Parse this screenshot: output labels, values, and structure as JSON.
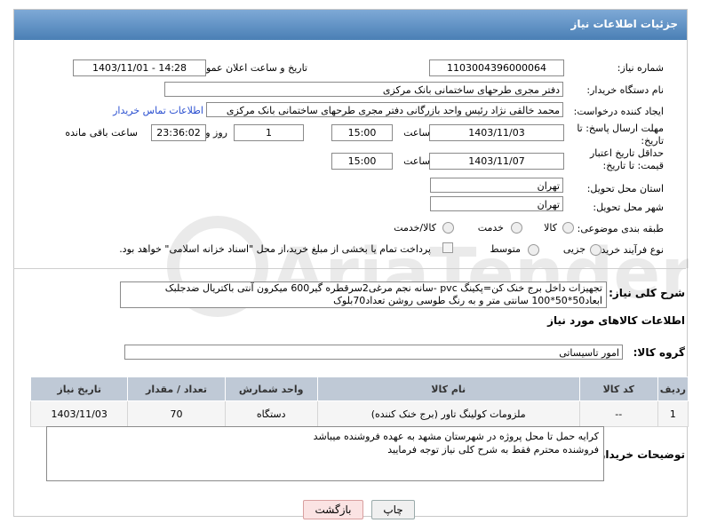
{
  "header": {
    "title": "جزئیات اطلاعات نیاز"
  },
  "fields": {
    "need_number_label": "شماره نیاز:",
    "need_number": "1103004396000064",
    "announce_label": "تاریخ و ساعت اعلان عمومی:",
    "announce_value": "1403/11/01 - 14:28",
    "buyer_org_label": "نام دستگاه خریدار:",
    "buyer_org": "دفتر مجری طرحهای ساختمانی بانک مرکزی",
    "creator_label": "ایجاد کننده درخواست:",
    "creator": "محمد خالقی نژاد رئیس واحد بازرگانی دفتر مجری طرحهای ساختمانی بانک مرکزی",
    "contact_link": "اطلاعات تماس خریدار",
    "deadline_label": "مهلت ارسال پاسخ: تا تاریخ:",
    "deadline_date": "1403/11/03",
    "time_label": "ساعت",
    "deadline_time": "15:00",
    "day_value": "1",
    "day_label": "روز و",
    "remaining_time": "23:36:02",
    "remaining_label": "ساعت باقی مانده",
    "price_valid_label": "حداقل تاریخ اعتبار قیمت: تا تاریخ:",
    "price_valid_date": "1403/11/07",
    "price_valid_time": "15:00",
    "province_label": "استان محل تحویل:",
    "province": "تهران",
    "city_label": "شهر محل تحویل:",
    "city": "تهران",
    "category_label": "طبقه بندی موضوعی:",
    "category_options": [
      "کالا",
      "خدمت",
      "کالا/خدمت"
    ],
    "process_label": "نوع فرآیند خرید :",
    "process_options": [
      "جزیی",
      "متوسط"
    ],
    "process_note": "پرداخت تمام یا بخشی از مبلغ خرید،از محل \"اسناد خزانه اسلامی\" خواهد بود.",
    "description_label": "شرح کلی نیاز:",
    "description_line1": "تجهیزات داخل برج خنک کن=پکینگ pvc -سانه نجم مرغی2سرقطره گیر600 میکرون آنتی باکتریال ضدجلبک",
    "description_line2": "ابعاد50*50*100 سانتی متر و به رنگ طوسی روشن تعداد70بلوک",
    "goods_info_title": "اطلاعات کالاهای مورد نیاز",
    "goods_group_label": "گروه کالا:",
    "goods_group": "امور تاسیساتی",
    "notes_label": "توضیحات خریدار:",
    "notes_line1": "کرایه حمل تا محل پروژه در شهرستان مشهد به عهده فروشنده میباشد",
    "notes_line2": "فروشنده محترم فقط به شرح کلی نیاز توجه فرمایید"
  },
  "table": {
    "headers": [
      "ردیف",
      "کد کالا",
      "نام کالا",
      "واحد شمارش",
      "تعداد / مقدار",
      "تاریخ نیاز"
    ],
    "rows": [
      [
        "1",
        "--",
        "ملزومات کولینگ تاور (برج خنک کننده)",
        "دستگاه",
        "70",
        "1403/11/03"
      ]
    ]
  },
  "buttons": {
    "print": "چاپ",
    "back": "بازگشت"
  },
  "watermark_text": "AriaTender.neT"
}
